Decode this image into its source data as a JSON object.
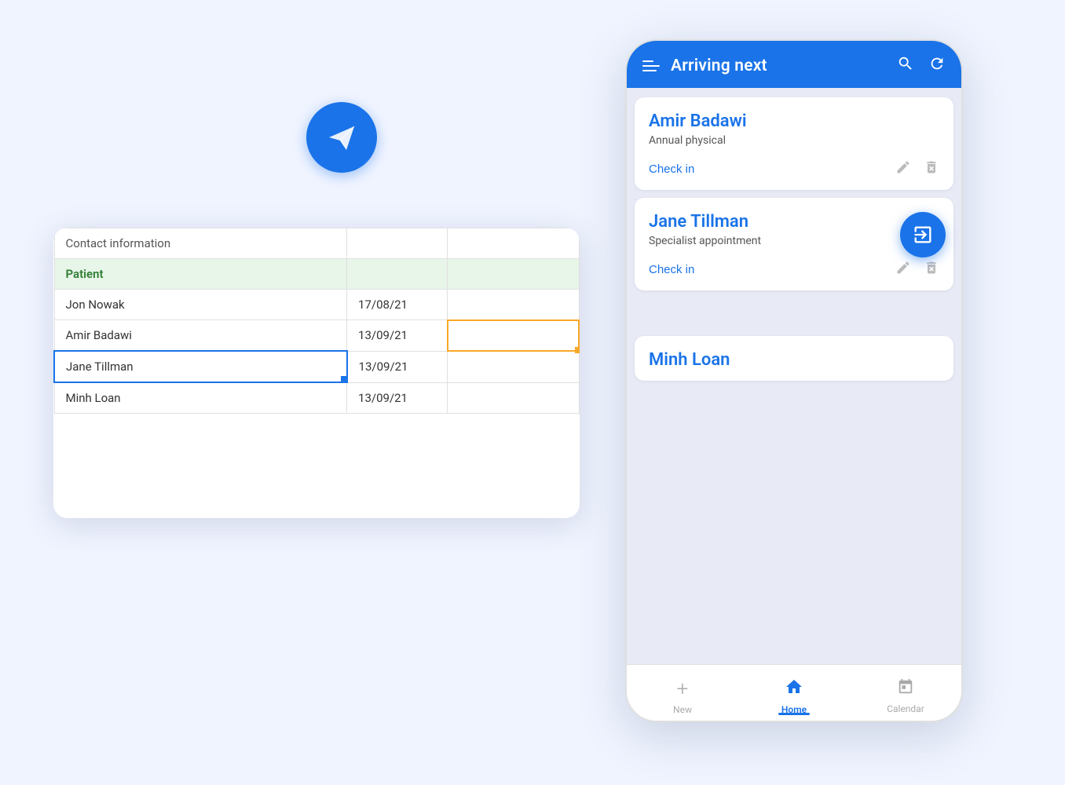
{
  "app": {
    "title": "Arriving next",
    "plane_icon": "paper-plane",
    "accent_color": "#1a73e8"
  },
  "spreadsheet": {
    "columns": [
      "",
      "",
      ""
    ],
    "rows": [
      {
        "type": "header",
        "cells": [
          "Contact information",
          "",
          ""
        ]
      },
      {
        "type": "section",
        "cells": [
          "Patient",
          "",
          ""
        ]
      },
      {
        "type": "normal",
        "cells": [
          "Jon Nowak",
          "17/08/21",
          ""
        ]
      },
      {
        "type": "yellow",
        "cells": [
          "Amir Badawi",
          "13/09/21",
          ""
        ]
      },
      {
        "type": "selected",
        "cells": [
          "Jane Tillman",
          "13/09/21",
          ""
        ]
      },
      {
        "type": "normal",
        "cells": [
          "Minh Loan",
          "13/09/21",
          ""
        ]
      }
    ]
  },
  "patients": [
    {
      "name": "Amir Badawi",
      "appointment": "Annual physical",
      "check_in_label": "Check in"
    },
    {
      "name": "Jane Tillman",
      "appointment": "Specialist appointment",
      "check_in_label": "Check in"
    },
    {
      "name": "Minh Loan",
      "appointment": "",
      "check_in_label": ""
    }
  ],
  "bottom_nav": [
    {
      "label": "New",
      "icon": "+",
      "active": false
    },
    {
      "label": "Home",
      "icon": "🏠",
      "active": true
    },
    {
      "label": "Calendar",
      "icon": "📅",
      "active": false
    }
  ],
  "header_icons": {
    "search": "🔍",
    "refresh": "↻"
  }
}
